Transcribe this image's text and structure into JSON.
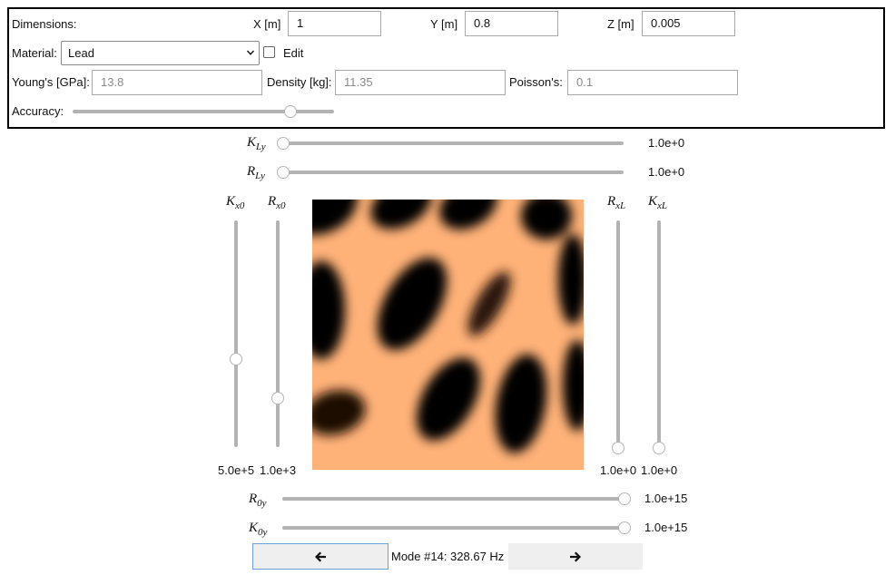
{
  "dimensions": {
    "label": "Dimensions:",
    "x_label": "X [m]",
    "x_value": "1",
    "y_label": "Y [m]",
    "y_value": "0.8",
    "z_label": "Z [m]",
    "z_value": "0.005"
  },
  "material": {
    "label": "Material:",
    "selected": "Lead",
    "edit_label": "Edit",
    "edit_checked": false
  },
  "properties": {
    "youngs_label": "Young's [GPa]:",
    "youngs_value": "13.8",
    "density_label": "Density [kg]:",
    "density_value": "11.35",
    "poisson_label": "Poisson's:",
    "poisson_value": "0.1"
  },
  "accuracy": {
    "label": "Accuracy:",
    "level": 0.85
  },
  "sliders": {
    "K_Ly": {
      "sym": "K",
      "sub": "Ly",
      "value": "1.0e+0",
      "level": 0.0
    },
    "R_Ly": {
      "sym": "R",
      "sub": "Ly",
      "value": "1.0e+0",
      "level": 0.0
    },
    "K_x0": {
      "sym": "K",
      "sub": "x0",
      "value": "5.0e+5",
      "level": 0.38
    },
    "R_x0": {
      "sym": "R",
      "sub": "x0",
      "value": "1.0e+3",
      "level": 0.2
    },
    "R_xL": {
      "sym": "R",
      "sub": "xL",
      "value": "1.0e+0",
      "level": 0.0
    },
    "K_xL": {
      "sym": "K",
      "sub": "xL",
      "value": "1.0e+0",
      "level": 0.0
    },
    "R_0y": {
      "sym": "R",
      "sub": "0y",
      "value": "1.0e+15",
      "level": 1.0
    },
    "K_0y": {
      "sym": "K",
      "sub": "0y",
      "value": "1.0e+15",
      "level": 1.0
    }
  },
  "mode": {
    "label": "Mode #14: 328.67 Hz",
    "prev_icon": "arrow-left-icon",
    "next_icon": "arrow-right-icon"
  },
  "colors": {
    "mode_dark": "#000000",
    "mode_light": "#ffb278"
  }
}
